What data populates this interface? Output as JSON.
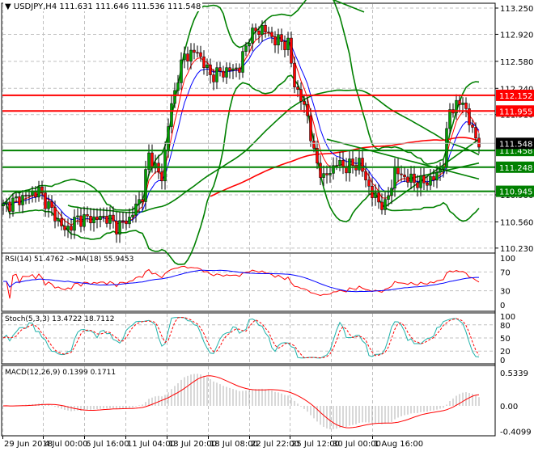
{
  "header": {
    "symbol_label": "USDJPY,H4",
    "ohlc": "111.631 111.646 111.536 111.548"
  },
  "colors": {
    "bull": "#00a000",
    "bear": "#ff0000",
    "bands": "#008000",
    "ma_fast": "#0000ff",
    "ma_slow": "#ff0000",
    "level_red": "#ff0000",
    "level_green": "#008000",
    "stoch_main": "#20b2aa",
    "stoch_signal": "#ff0000",
    "macd_hist": "#b0b0b0",
    "macd_signal": "#ff0000",
    "rsi": "#ff0000",
    "rsi_ma": "#0000ff",
    "grid": "#c0c0c0"
  },
  "price_axis": {
    "ticks": [
      "113.250",
      "112.920",
      "112.580",
      "112.240",
      "111.910",
      "110.900",
      "110.560",
      "110.230"
    ]
  },
  "levels": [
    {
      "value": "112.152",
      "color": "red"
    },
    {
      "value": "111.955",
      "color": "red"
    },
    {
      "value": "111.458",
      "color": "green"
    },
    {
      "value": "111.248",
      "color": "green"
    },
    {
      "value": "110.945",
      "color": "green"
    }
  ],
  "current_price": "111.548",
  "time_axis": [
    "29 Jun 2018",
    "4 Jul 00:00",
    "6 Jul 16:00",
    "11 Jul 04:00",
    "13 Jul 20:00",
    "18 Jul 08:00",
    "22 Jul 22:00",
    "25 Jul 12:00",
    "30 Jul 00:00",
    "1 Aug 16:00"
  ],
  "rsi": {
    "label": "RSI(14) 51.4762  ->MA(18) 55.9453",
    "ticks": [
      "100",
      "70",
      "30",
      "0"
    ]
  },
  "stoch": {
    "label": "Stoch(5,3,3) 13.4722 18.7112",
    "ticks": [
      "100",
      "80",
      "50",
      "20",
      "0"
    ]
  },
  "macd": {
    "label": "MACD(12,26,9) 0.1399 0.1711",
    "ticks": [
      "0.5339",
      "0.00",
      "-0.4099"
    ]
  },
  "chart_data": {
    "type": "candlestick",
    "symbol": "USDJPY",
    "timeframe": "H4",
    "ylim": [
      110.23,
      113.25
    ],
    "price_path": [
      [
        0,
        110.75
      ],
      [
        5,
        110.85
      ],
      [
        11,
        110.95
      ],
      [
        15,
        110.7
      ],
      [
        19,
        110.45
      ],
      [
        23,
        110.6
      ],
      [
        28,
        110.6
      ],
      [
        32,
        110.62
      ],
      [
        35,
        110.5
      ],
      [
        39,
        110.6
      ],
      [
        43,
        110.9
      ],
      [
        45,
        111.4
      ],
      [
        49,
        111.1
      ],
      [
        51,
        111.8
      ],
      [
        54,
        112.4
      ],
      [
        56,
        112.65
      ],
      [
        60,
        112.7
      ],
      [
        64,
        112.4
      ],
      [
        68,
        112.45
      ],
      [
        73,
        112.5
      ],
      [
        76,
        112.9
      ],
      [
        80,
        113.0
      ],
      [
        84,
        112.85
      ],
      [
        88,
        112.8
      ],
      [
        90,
        112.3
      ],
      [
        94,
        111.9
      ],
      [
        96,
        111.4
      ],
      [
        99,
        111.1
      ],
      [
        103,
        111.3
      ],
      [
        106,
        111.25
      ],
      [
        110,
        111.3
      ],
      [
        114,
        110.9
      ],
      [
        118,
        110.75
      ],
      [
        121,
        111.2
      ],
      [
        125,
        111.1
      ],
      [
        129,
        111.05
      ],
      [
        133,
        111.1
      ],
      [
        136,
        111.3
      ],
      [
        138,
        112.0
      ],
      [
        140,
        112.0
      ],
      [
        142,
        112.1
      ],
      [
        144,
        111.8
      ],
      [
        147,
        111.55
      ]
    ]
  }
}
